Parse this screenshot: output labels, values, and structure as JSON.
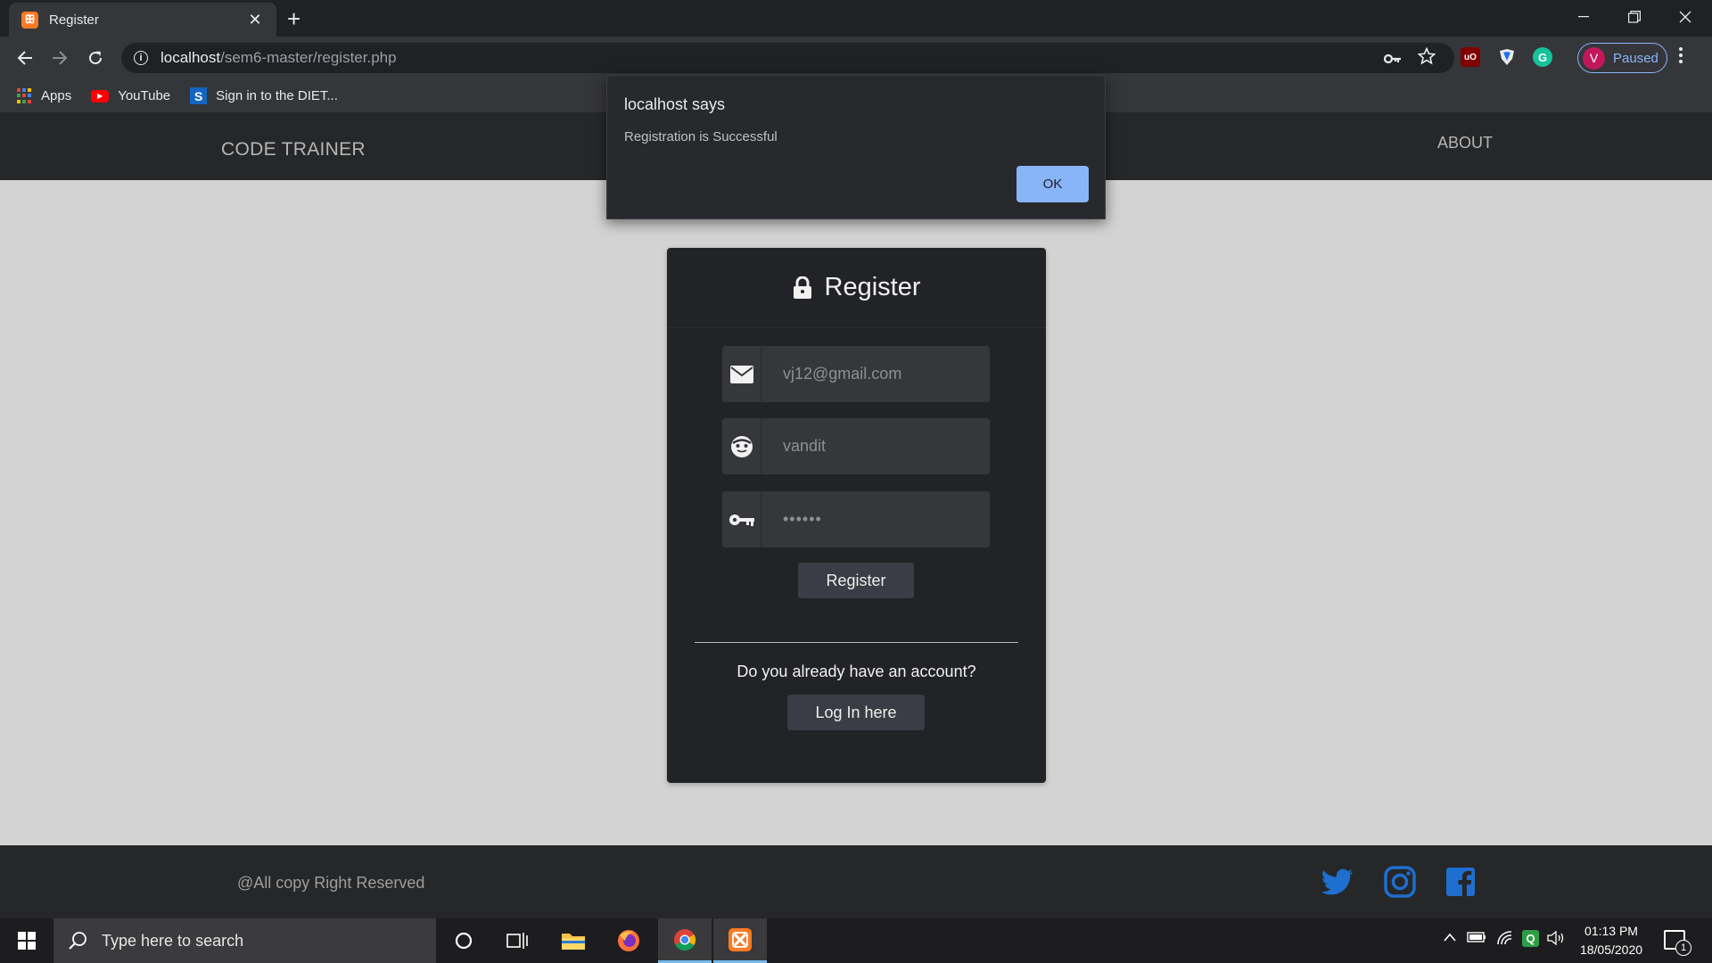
{
  "browser": {
    "tab_title": "Register",
    "tab_favicon_glyph": "ꕥ",
    "close_glyph": "✕",
    "new_tab_glyph": "+",
    "url_host": "localhost",
    "url_path": "/sem6-master/register.php",
    "profile_initial": "V",
    "profile_status": "Paused",
    "ext_ublock": "uO",
    "ext_grammarly": "G",
    "bookmarks": [
      {
        "label": "Apps",
        "icon": "apps-grid-icon"
      },
      {
        "label": "YouTube",
        "icon": "youtube-icon"
      },
      {
        "label": "Sign in to the DIET...",
        "icon": "s-icon",
        "icon_letter": "S"
      }
    ],
    "accent_color": "#8ab4f8"
  },
  "site": {
    "brand": "CODE TRAINER",
    "nav_about": "ABOUT",
    "form": {
      "title": "Register",
      "email_value": "vj12@gmail.com",
      "username_value": "vandit",
      "password_value": "••••••",
      "register_button": "Register",
      "question": "Do you already have an account?",
      "login_button": "Log In here"
    },
    "footer": {
      "copyright": "@All copy Right Reserved",
      "social": [
        "twitter-icon",
        "instagram-icon",
        "facebook-icon"
      ],
      "social_color": "#1e6fd0"
    }
  },
  "alert": {
    "title": "localhost says",
    "message": "Registration is Successful",
    "ok_label": "OK"
  },
  "taskbar": {
    "search_placeholder": "Type here to search",
    "time": "01:13 PM",
    "date": "18/05/2020",
    "notification_count": "1",
    "tray_q": "Q"
  }
}
